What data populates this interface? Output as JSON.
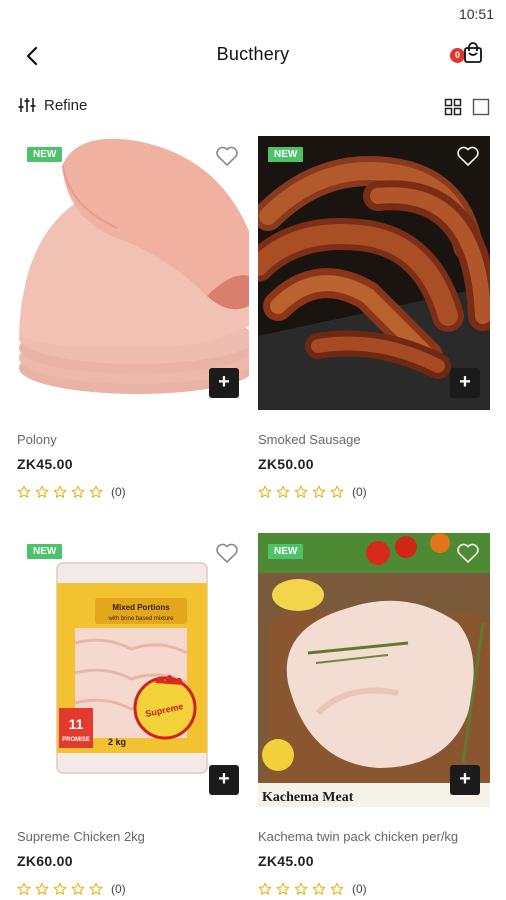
{
  "status": {
    "time": "10:51"
  },
  "header": {
    "title": "Bucthery",
    "cart_count": "0",
    "back_icon": "chevron-left-icon",
    "cart_icon": "shopping-bag-icon"
  },
  "toolbar": {
    "refine_label": "Refine",
    "refine_icon": "sliders-icon",
    "grid_icon": "grid-view-icon",
    "list_icon": "square-view-icon"
  },
  "products": [
    {
      "badge": "NEW",
      "name": "Polony",
      "price": "ZK45.00",
      "rating": 0,
      "rating_count": "(0)",
      "add_label": "+"
    },
    {
      "badge": "NEW",
      "name": "Smoked Sausage",
      "price": "ZK50.00",
      "rating": 0,
      "rating_count": "(0)",
      "add_label": "+"
    },
    {
      "badge": "NEW",
      "name": "Supreme Chicken 2kg",
      "price": "ZK60.00",
      "rating": 0,
      "rating_count": "(0)",
      "add_label": "+",
      "pack_text_1": "Mixed Portions",
      "pack_text_2": "with brine based mixture",
      "pack_text_3": "11",
      "pack_text_4": "PROMISE",
      "pack_text_5": "2 kg",
      "pack_brand": "Supreme"
    },
    {
      "badge": "NEW",
      "name": "Kachema twin pack chicken per/kg",
      "price": "ZK45.00",
      "rating": 0,
      "rating_count": "(0)",
      "add_label": "+",
      "image_caption": "Kachema Meat"
    }
  ],
  "colors": {
    "badge": "#4cc36b",
    "cart_badge": "#e3342f",
    "add_button": "#1b1b1b",
    "star": "#e8b21a"
  }
}
